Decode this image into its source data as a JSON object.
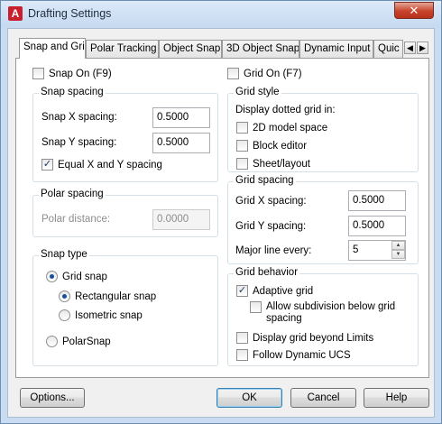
{
  "window": {
    "title": "Drafting Settings",
    "app_icon": "A",
    "close_glyph": "✕"
  },
  "tabs": [
    {
      "label": "Snap and Grid",
      "active": true
    },
    {
      "label": "Polar Tracking"
    },
    {
      "label": "Object Snap"
    },
    {
      "label": "3D Object Snap"
    },
    {
      "label": "Dynamic Input"
    },
    {
      "label": "Quic"
    }
  ],
  "tab_scroll": {
    "left": "◀",
    "right": "▶"
  },
  "snap_on": {
    "label": "Snap On (F9)",
    "checked": false
  },
  "grid_on": {
    "label": "Grid On (F7)",
    "checked": false
  },
  "snap_spacing": {
    "legend": "Snap spacing",
    "x_label": "Snap X spacing:",
    "x_value": "0.5000",
    "y_label": "Snap Y spacing:",
    "y_value": "0.5000",
    "equal_label": "Equal X and Y spacing",
    "equal_checked": true
  },
  "polar_spacing": {
    "legend": "Polar spacing",
    "distance_label": "Polar distance:",
    "distance_value": "0.0000"
  },
  "snap_type": {
    "legend": "Snap type",
    "grid_snap": "Grid snap",
    "rectangular_snap": "Rectangular snap",
    "isometric_snap": "Isometric snap",
    "polar_snap": "PolarSnap"
  },
  "grid_style": {
    "legend": "Grid style",
    "caption": "Display dotted grid in:",
    "model_space": "2D model space",
    "block_editor": "Block editor",
    "sheet_layout": "Sheet/layout"
  },
  "grid_spacing": {
    "legend": "Grid spacing",
    "x_label": "Grid X spacing:",
    "x_value": "0.5000",
    "y_label": "Grid Y spacing:",
    "y_value": "0.5000",
    "major_label": "Major line every:",
    "major_value": "5"
  },
  "grid_behavior": {
    "legend": "Grid behavior",
    "adaptive": "Adaptive grid",
    "adaptive_checked": true,
    "allow_subdivision_line1": "Allow subdivision below grid",
    "allow_subdivision_line2": "spacing",
    "beyond_limits": "Display grid beyond Limits",
    "follow_ucs": "Follow Dynamic UCS"
  },
  "buttons": {
    "options": "Options...",
    "ok": "OK",
    "cancel": "Cancel",
    "help": "Help"
  },
  "colors": {
    "accent": "#1a4f9c",
    "close": "#c7432b",
    "title_bg": "#c5d9f0"
  }
}
